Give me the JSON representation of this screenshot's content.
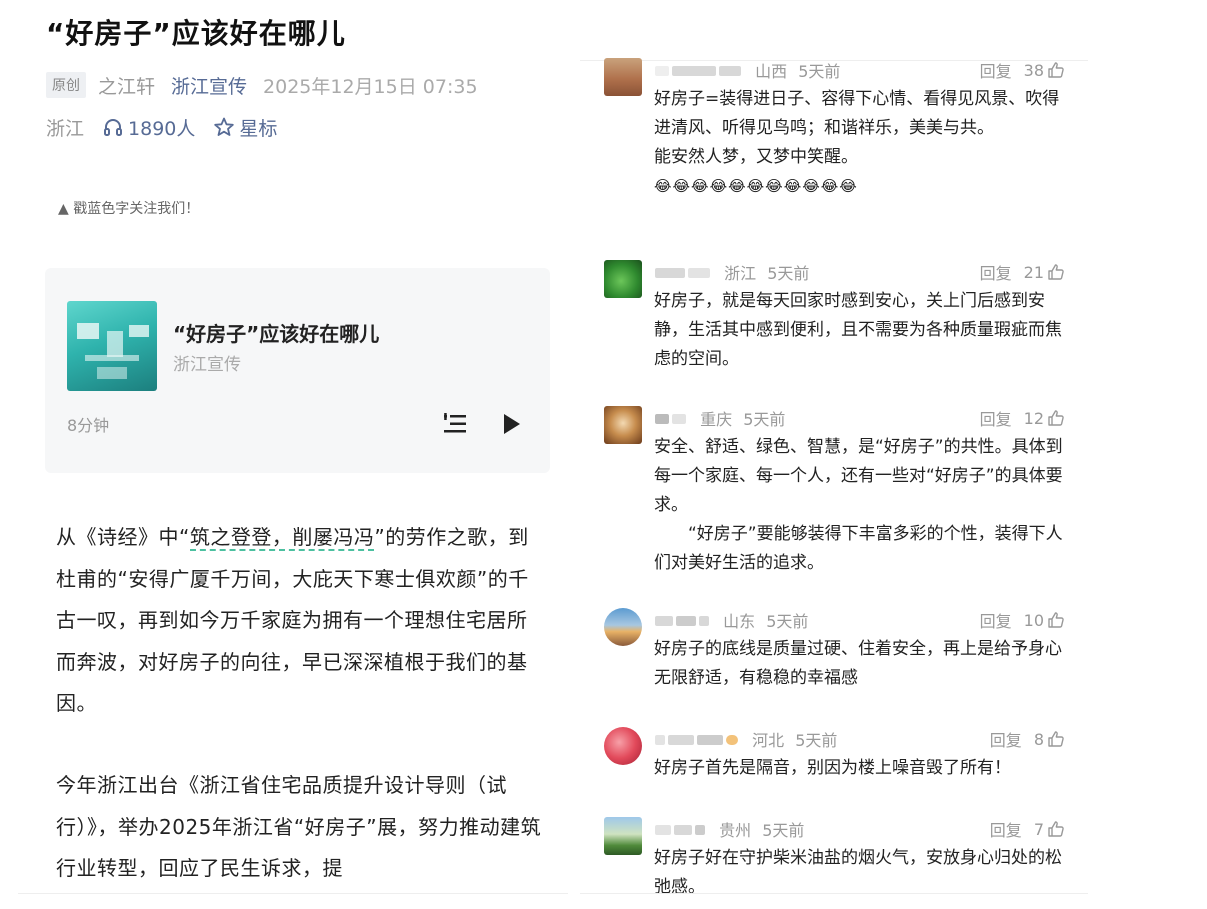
{
  "article": {
    "title": "“好房子”应该好在哪儿",
    "badge": "原创",
    "author": "之江轩",
    "account": "浙江宣传",
    "date": "2025年12月15日 07:35",
    "region": "浙江",
    "listeners": "1890人",
    "star_label": "星标",
    "follow_tip": "▲ 戳蓝色字关注我们！",
    "audio": {
      "title": "“好房子”应该好在哪儿",
      "source": "浙江宣传",
      "duration": "8分钟"
    },
    "para1_pre": "从《诗经》中“",
    "para1_hl": "筑之登登，削屡冯冯",
    "para1_post": "”的劳作之歌，到杜甫的“安得广厦千万间，大庇天下寒士俱欢颜”的千古一叹，再到如今万千家庭为拥有一个理想住宅居所而奔波，对好房子的向往，早已深深植根于我们的基因。",
    "para2": "今年浙江出台《浙江省住宅品质提升设计导则（试行）》，举办2025年浙江省“好房子”展，努力推动建筑行业转型，回应了民生诉求，提"
  },
  "comments": [
    {
      "location": "山西",
      "time": "5天前",
      "reply": "回复",
      "likes": "38",
      "lines": [
        "好房子=装得进日子、容得下心情、看得见风景、吹得进清风、听得见鸟鸣；和谐祥乐，美美与共。",
        "能安然人梦，又梦中笑醒。"
      ],
      "emoji": "😂😂😂😂😂😂😂😂😂😂😂"
    },
    {
      "location": "浙江",
      "time": "5天前",
      "reply": "回复",
      "likes": "21",
      "lines": [
        "好房子，就是每天回家时感到安心，关上门后感到安静，生活其中感到便利，且不需要为各种质量瑕疵而焦虑的空间。"
      ]
    },
    {
      "location": "重庆",
      "time": "5天前",
      "reply": "回复",
      "likes": "12",
      "lines": [
        "安全、舒适、绿色、智慧，是“好房子”的共性。具体到每一个家庭、每一个人，还有一些对“好房子”的具体要求。",
        "“好房子”要能够装得下丰富多彩的个性，装得下人们对美好生活的追求。"
      ]
    },
    {
      "location": "山东",
      "time": "5天前",
      "reply": "回复",
      "likes": "10",
      "lines": [
        "好房子的底线是质量过硬、住着安全，再上是给予身心无限舒适，有稳稳的幸福感"
      ]
    },
    {
      "location": "河北",
      "time": "5天前",
      "reply": "回复",
      "likes": "8",
      "lines": [
        "好房子首先是隔音，别因为楼上噪音毁了所有！"
      ]
    },
    {
      "location": "贵州",
      "time": "5天前",
      "reply": "回复",
      "likes": "7",
      "lines": [
        "好房子好在守护柴米油盐的烟火气，安放身心归处的松弛感。"
      ]
    }
  ],
  "colors": {
    "link": "#576b95",
    "highlight_underline": "#4cc0a0",
    "card_bg": "#f6f7f8"
  },
  "icons": {
    "listen": "headphone-icon",
    "star": "star-outline-icon",
    "like": "thumbs-up-icon",
    "playlist": "playlist-icon",
    "play": "play-icon"
  }
}
